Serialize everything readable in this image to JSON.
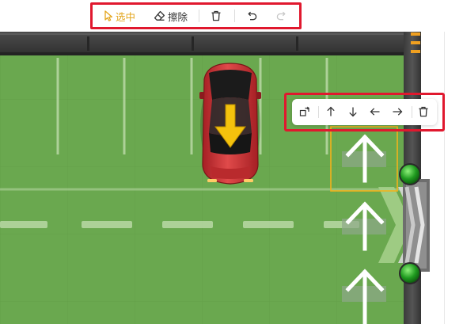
{
  "toolbar": {
    "select_label": "选中",
    "erase_label": "擦除",
    "icons": [
      "pointer-icon",
      "eraser-icon",
      "trash-icon",
      "undo-icon",
      "redo-icon"
    ],
    "active_color": "#e3a51c",
    "disabled_color": "#c8c8c8"
  },
  "element_toolbar": {
    "icons": [
      "rotate-icon",
      "arrow-up-icon",
      "arrow-down-icon",
      "arrow-left-icon",
      "arrow-right-icon",
      "trash-icon"
    ]
  },
  "scene": {
    "grass_color": "#6aa84f",
    "lane_arrows": [
      "up",
      "up",
      "up"
    ],
    "car_direction": "down",
    "car_color": "#d9373a",
    "gate_lights": [
      "green",
      "green"
    ],
    "selection_color": "#f2b21b",
    "highlight_color": "#e0182e"
  }
}
